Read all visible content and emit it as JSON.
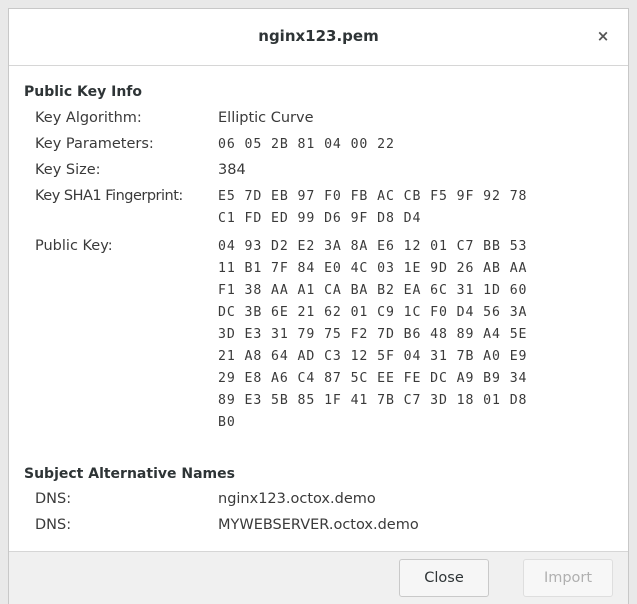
{
  "window": {
    "title": "nginx123.pem",
    "close_glyph": "×"
  },
  "public_key_info": {
    "heading": "Public Key Info",
    "rows": [
      {
        "label": "Key Algorithm:",
        "value": "Elliptic Curve"
      },
      {
        "label": "Key Parameters:",
        "value": "06 05 2B 81 04 00 22"
      },
      {
        "label": "Key Size:",
        "value": "384"
      }
    ],
    "fingerprint": {
      "label": "Key SHA1 Fingerprint:",
      "lines": [
        "E5 7D EB 97 F0 FB AC CB F5 9F 92 78",
        "C1 FD ED 99 D6 9F D8 D4"
      ]
    },
    "public_key": {
      "label": "Public Key:",
      "lines": [
        "04 93 D2 E2 3A 8A E6 12 01 C7 BB 53",
        "11 B1 7F 84 E0 4C 03 1E 9D 26 AB AA",
        "F1 38 AA A1 CA BA B2 EA 6C 31 1D 60",
        "DC 3B 6E 21 62 01 C9 1C F0 D4 56 3A",
        "3D E3 31 79 75 F2 7D B6 48 89 A4 5E",
        "21 A8 64 AD C3 12 5F 04 31 7B A0 E9",
        "29 E8 A6 C4 87 5C EE FE DC A9 B9 34",
        "89 E3 5B 85 1F 41 7B C7 3D 18 01 D8",
        "B0"
      ]
    }
  },
  "san": {
    "heading": "Subject Alternative Names",
    "rows": [
      {
        "label": "DNS:",
        "value": "nginx123.octox.demo"
      },
      {
        "label": "DNS:",
        "value": "MYWEBSERVER.octox.demo"
      }
    ]
  },
  "buttons": {
    "close": "Close",
    "import": "Import"
  }
}
